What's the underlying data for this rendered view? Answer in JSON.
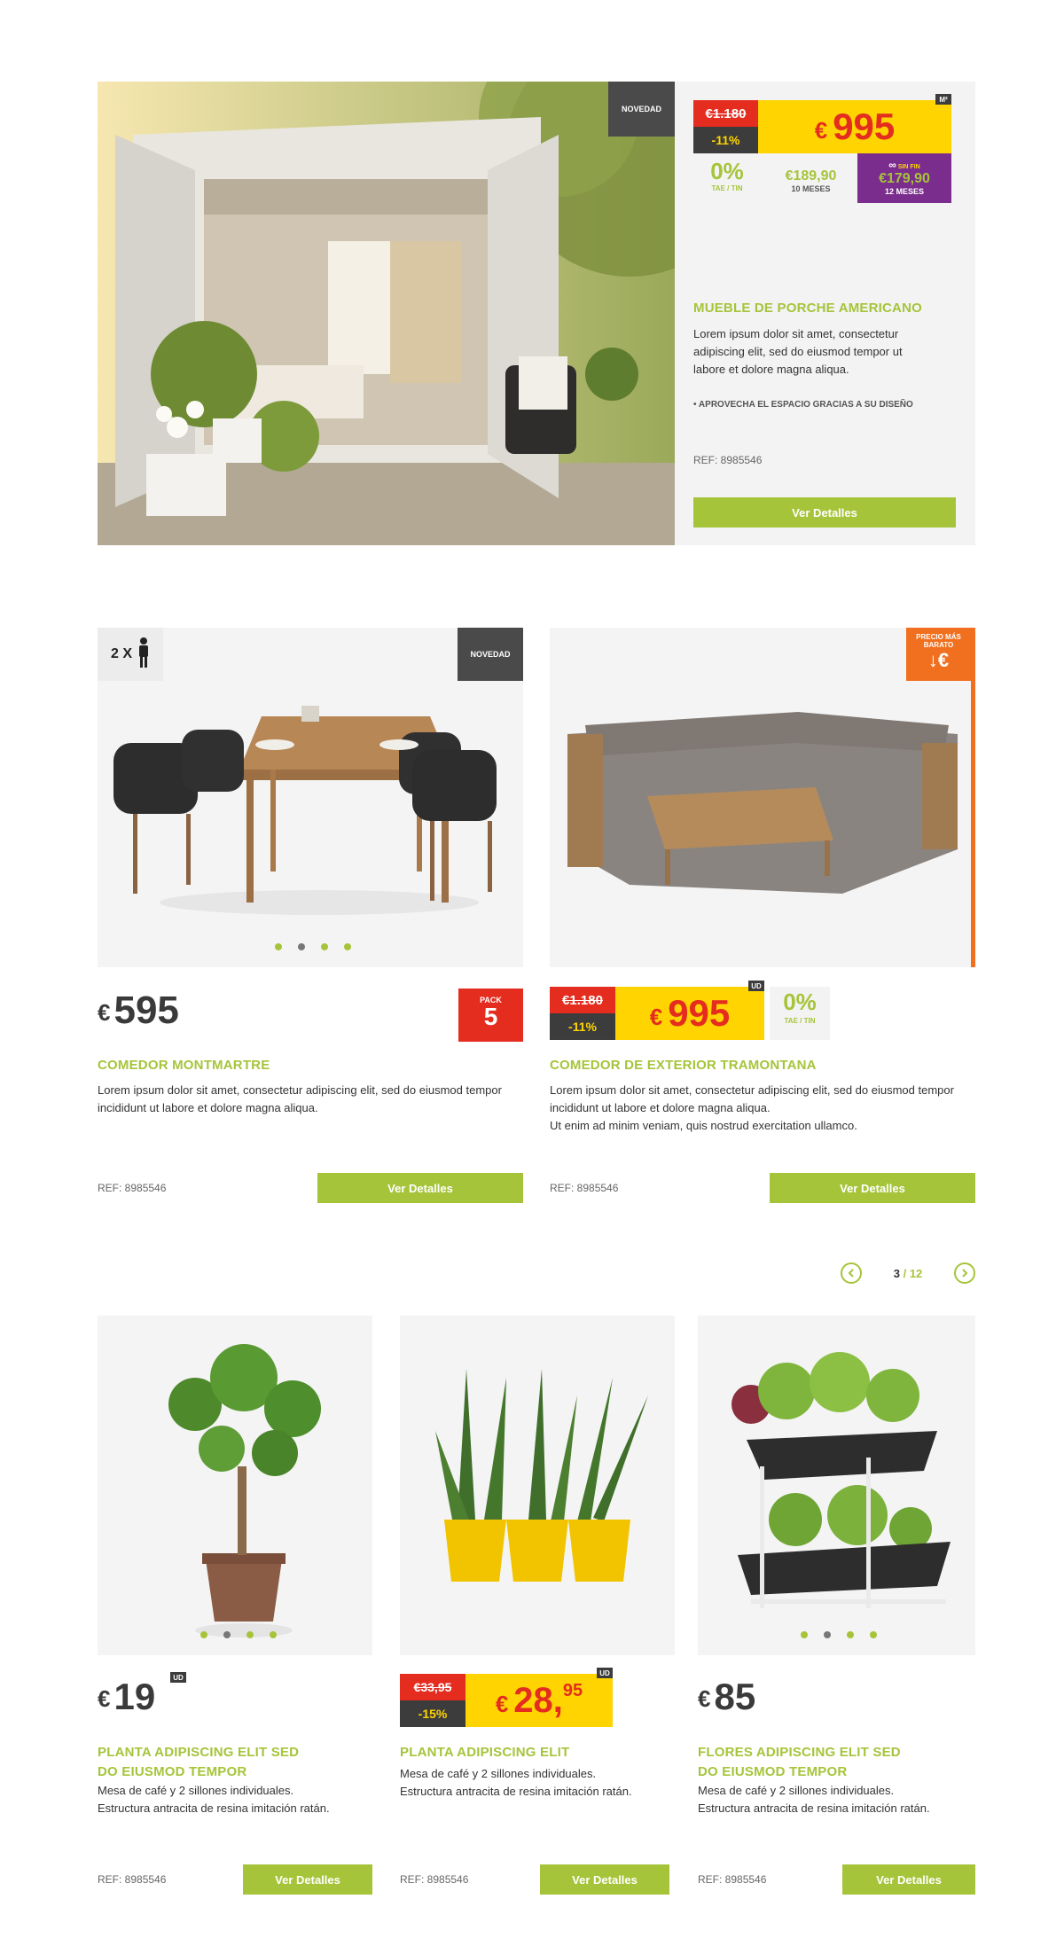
{
  "hero": {
    "badge": "NOVEDAD",
    "old_price": "€1.180",
    "discount": "-11%",
    "price_currency": "€",
    "price": "995",
    "unit": "M²",
    "financing_rate": "0%",
    "financing_rate_label": "TAE / TIN",
    "financing_monthly": "€189,90",
    "financing_months": "10 MESES",
    "financing_card_logo": "SIN FIN",
    "financing_card_monthly": "€179,90",
    "financing_card_months": "12 MESES",
    "title": "MUEBLE DE PORCHE AMERICANO",
    "description": "Lorem ipsum dolor sit amet, consectetur adipiscing elit, sed do eiusmod tempor ut labore et dolore magna aliqua.",
    "bullet": "APROVECHA EL ESPACIO GRACIAS A SU DISEÑO",
    "ref": "REF: 8985546",
    "button": "Ver Detalles"
  },
  "card1": {
    "persons": "2 X",
    "badge": "NOVEDAD",
    "price_currency": "€",
    "price": "595",
    "pack_label": "PACK",
    "pack_value": "5",
    "title": "COMEDOR MONTMARTRE",
    "description": "Lorem ipsum dolor sit amet, consectetur adipiscing elit, sed do eiusmod tempor incididunt ut labore et dolore magna aliqua.",
    "ref": "REF: 8985546",
    "button": "Ver Detalles"
  },
  "card2": {
    "badge_line1": "PRECIO MÁS",
    "badge_line2": "BARATO",
    "badge_symbol": "↓€",
    "old_price": "€1.180",
    "discount": "-11%",
    "price_currency": "€",
    "price": "995",
    "unit": "UD",
    "financing_rate": "0%",
    "financing_rate_label": "TAE / TIN",
    "title": "COMEDOR DE EXTERIOR TRAMONTANA",
    "description": "Lorem ipsum dolor sit amet, consectetur adipiscing elit, sed do eiusmod tempor incididunt ut labore et dolore magna aliqua.",
    "description2": "Ut enim ad minim veniam, quis nostrud exercitation ullamco.",
    "ref": "REF: 8985546",
    "button": "Ver Detalles"
  },
  "pagination": {
    "current": "3",
    "separator": "/",
    "total": "12"
  },
  "plant1": {
    "price_currency": "€",
    "price": "19",
    "unit": "UD",
    "title_line1": "PLANTA ADIPISCING ELIT SED",
    "title_line2": "DO EIUSMOD TEMPOR",
    "desc_line1": "Mesa de café y 2 sillones individuales.",
    "desc_line2": "Estructura antracita de resina imitación ratán.",
    "ref": "REF: 8985546",
    "button": "Ver Detalles"
  },
  "plant2": {
    "old_price": "€33,95",
    "discount": "-15%",
    "price_currency": "€",
    "price": "28,",
    "price_cents": "95",
    "unit": "UD",
    "title_line1": "PLANTA ADIPISCING ELIT",
    "desc_line1": "Mesa de café y 2 sillones individuales.",
    "desc_line2": "Estructura antracita de resina imitación ratán.",
    "ref": "REF: 8985546",
    "button": "Ver Detalles"
  },
  "plant3": {
    "price_currency": "€",
    "price": "85",
    "title_line1": "FLORES ADIPISCING ELIT SED",
    "title_line2": "DO EIUSMOD TEMPOR",
    "desc_line1": "Mesa de café y 2 sillones individuales.",
    "desc_line2": "Estructura antracita de resina imitación ratán.",
    "ref": "REF: 8985546",
    "button": "Ver Detalles"
  },
  "colors": {
    "accent_green": "#a6c43a",
    "price_red": "#e42c1f",
    "price_yellow": "#ffd400",
    "orange": "#f07020",
    "purple": "#7b2d8e"
  }
}
